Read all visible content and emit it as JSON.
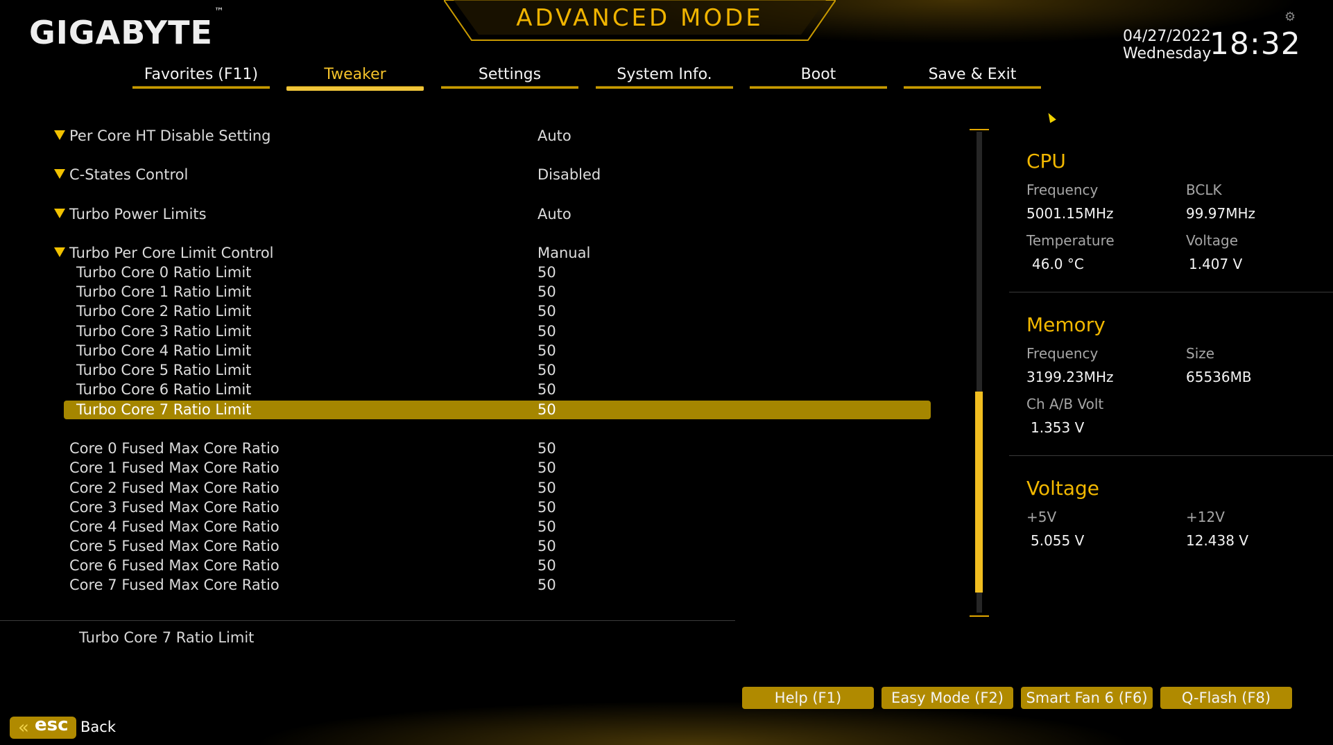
{
  "header": {
    "logo": "GIGABYTE",
    "logo_tm": "™",
    "title": "ADVANCED MODE",
    "date": "04/27/2022",
    "weekday": "Wednesday",
    "time": "18:32"
  },
  "tabs": [
    {
      "label": "Favorites (F11)",
      "active": false
    },
    {
      "label": "Tweaker",
      "active": true
    },
    {
      "label": "Settings",
      "active": false
    },
    {
      "label": "System Info.",
      "active": false
    },
    {
      "label": "Boot",
      "active": false
    },
    {
      "label": "Save & Exit",
      "active": false
    }
  ],
  "settings": [
    {
      "name": "Per Core HT Disable Setting",
      "value": "Auto",
      "expandable": true
    },
    {
      "name": "C-States Control",
      "value": "Disabled",
      "expandable": true
    },
    {
      "name": "Turbo Power Limits",
      "value": "Auto",
      "expandable": true
    },
    {
      "name": "Turbo Per Core Limit Control",
      "value": "Manual",
      "expandable": true
    },
    {
      "name": "Turbo Core 0 Ratio Limit",
      "value": "50"
    },
    {
      "name": "Turbo Core 1 Ratio Limit",
      "value": "50"
    },
    {
      "name": "Turbo Core 2 Ratio Limit",
      "value": "50"
    },
    {
      "name": "Turbo Core 3 Ratio Limit",
      "value": "50"
    },
    {
      "name": "Turbo Core 4 Ratio Limit",
      "value": "50"
    },
    {
      "name": "Turbo Core 5 Ratio Limit",
      "value": "50"
    },
    {
      "name": "Turbo Core 6 Ratio Limit",
      "value": "50"
    },
    {
      "name": "Turbo Core 7 Ratio Limit",
      "value": "50",
      "selected": true
    },
    {
      "name": "Core 0 Fused Max Core Ratio",
      "value": "50"
    },
    {
      "name": "Core 1 Fused Max Core Ratio",
      "value": "50"
    },
    {
      "name": "Core 2 Fused Max Core Ratio",
      "value": "50"
    },
    {
      "name": "Core 3 Fused Max Core Ratio",
      "value": "50"
    },
    {
      "name": "Core 4 Fused Max Core Ratio",
      "value": "50"
    },
    {
      "name": "Core 5 Fused Max Core Ratio",
      "value": "50"
    },
    {
      "name": "Core 6 Fused Max Core Ratio",
      "value": "50"
    },
    {
      "name": "Core 7 Fused Max Core Ratio",
      "value": "50"
    }
  ],
  "help_text": "Turbo Core 7 Ratio Limit",
  "monitor": {
    "cpu": {
      "heading": "CPU",
      "freq_label": "Frequency",
      "freq": "5001.15MHz",
      "bclk_label": "BCLK",
      "bclk": "99.97MHz",
      "temp_label": "Temperature",
      "temp": "46.0 °C",
      "volt_label": "Voltage",
      "volt": "1.407 V"
    },
    "memory": {
      "heading": "Memory",
      "freq_label": "Frequency",
      "freq": "3199.23MHz",
      "size_label": "Size",
      "size": "65536MB",
      "chvolt_label": "Ch A/B Volt",
      "chvolt": "1.353 V"
    },
    "voltage": {
      "heading": "Voltage",
      "v5_label": "+5V",
      "v5": "5.055 V",
      "v12_label": "+12V",
      "v12": "12.438 V"
    }
  },
  "buttons": [
    {
      "label": "Help (F1)"
    },
    {
      "label": "Easy Mode (F2)"
    },
    {
      "label": "Smart Fan 6 (F6)"
    },
    {
      "label": "Q-Flash (F8)"
    }
  ],
  "esc": {
    "key": "esc",
    "arrow": "«",
    "label": "Back"
  },
  "colors": {
    "accent": "#f2b800",
    "highlight": "#a58600",
    "button": "#b08a00"
  }
}
